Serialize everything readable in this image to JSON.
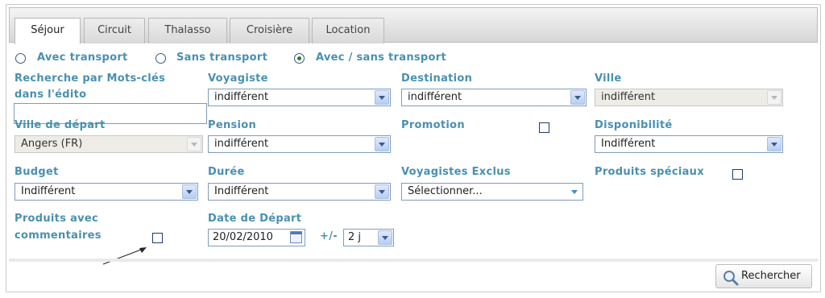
{
  "tabs": [
    "Séjour",
    "Circuit",
    "Thalasso",
    "Croisière",
    "Location"
  ],
  "transport": {
    "options": [
      "Avec transport",
      "Sans transport",
      "Avec / sans transport"
    ],
    "selected": "Avec / sans transport"
  },
  "fields": {
    "keywords_label_line1": "Recherche par Mots-clés",
    "keywords_label_line2": "dans l'édito",
    "keywords_value": "",
    "voyagiste_label": "Voyagiste",
    "voyagiste_value": "indifférent",
    "destination_label": "Destination",
    "destination_value": "indifférent",
    "ville_label": "Ville",
    "ville_value": "indifférent",
    "ville_depart_label": "Ville de départ",
    "ville_depart_value": "Angers (FR)",
    "pension_label": "Pension",
    "pension_value": "indifférent",
    "promotion_label": "Promotion",
    "disponibilite_label": "Disponibilité",
    "disponibilite_value": "Indifférent",
    "budget_label": "Budget",
    "budget_value": "Indifférent",
    "duree_label": "Durée",
    "duree_value": "Indifférent",
    "exclus_label": "Voyagistes Exclus",
    "exclus_value": "Sélectionner...",
    "speciaux_label": "Produits spéciaux",
    "commentaires_label_line1": "Produits avec",
    "commentaires_label_line2": "commentaires",
    "date_label": "Date de Départ",
    "date_value": "20/02/2010",
    "plusminus_label": "+/-",
    "plusminus_value": "2 j"
  },
  "search_button": "Rechercher",
  "colors": {
    "label": "#4a90b0",
    "accent_radio": "#2a7a2a"
  }
}
